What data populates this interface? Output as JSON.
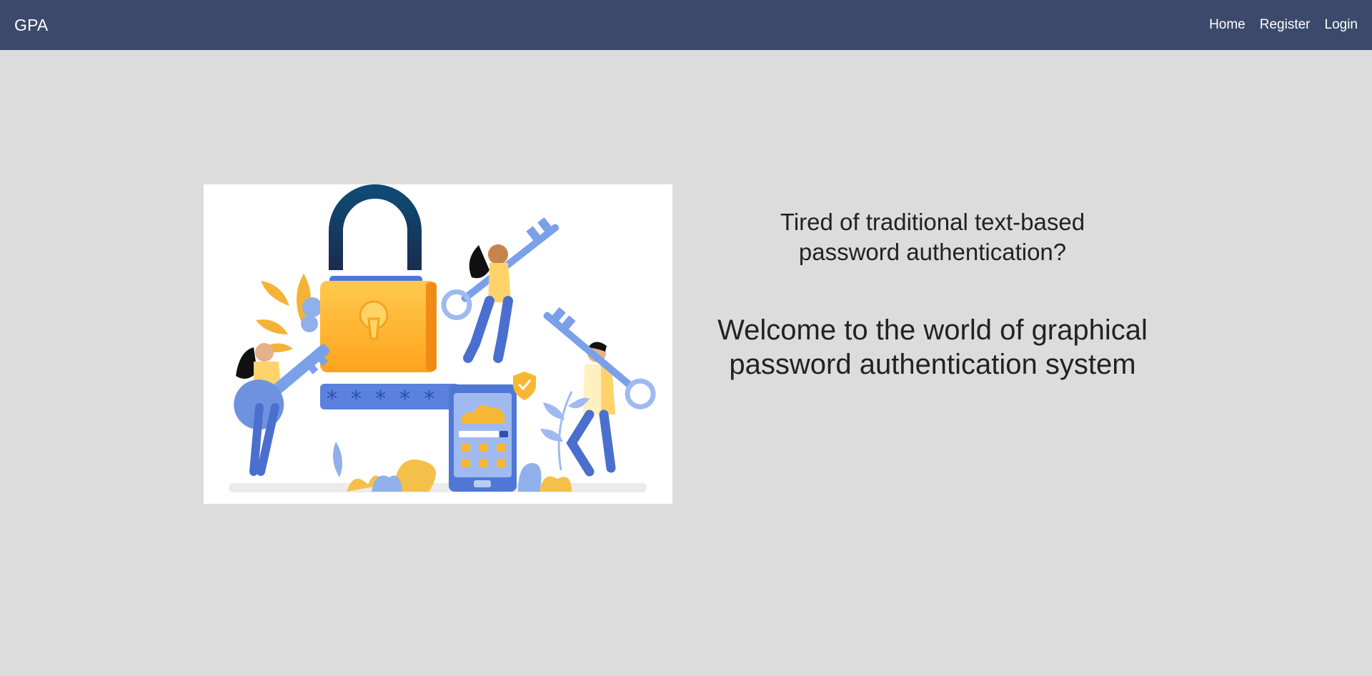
{
  "navbar": {
    "brand": "GPA",
    "links": [
      {
        "label": "Home"
      },
      {
        "label": "Register"
      },
      {
        "label": "Login"
      }
    ],
    "background": "#3b4a6b"
  },
  "hero": {
    "image_icon": "padlock-and-keys-illustration",
    "subtitle": "Tired of traditional text-based password authentication?",
    "title": "Welcome to the world of graphical password authentication system"
  },
  "page": {
    "background": "#dcdcdc"
  }
}
